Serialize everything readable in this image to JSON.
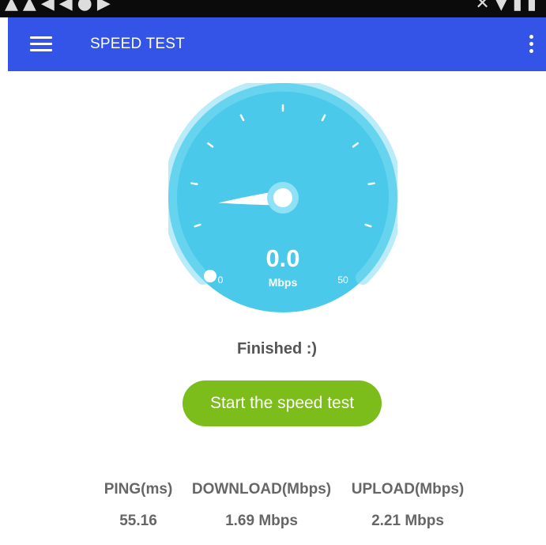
{
  "app_bar": {
    "title": "SPEED TEST"
  },
  "gauge": {
    "speed_value": "0.0",
    "unit": "Mbps",
    "min_label": "0",
    "max_label": "50",
    "needle_level": 0.15,
    "colors": {
      "face": "#4bc9ea",
      "inner": "#55cff0",
      "ring": "#7fdcf3",
      "marks": "#ffffff"
    }
  },
  "status": {
    "text": "Finished :)"
  },
  "start_button": {
    "label": "Start the speed test",
    "color": "#7cbd1b"
  },
  "metrics": {
    "ping": {
      "label": "PING(ms)",
      "value": "55.16"
    },
    "download": {
      "label": "DOWNLOAD(Mbps)",
      "value": "1.69 Mbps"
    },
    "upload": {
      "label": "UPLOAD(Mbps)",
      "value": "2.21 Mbps"
    }
  },
  "colors": {
    "app_bar": "#3454e8",
    "status_bar": "#0b0b0b",
    "text": "#666666"
  }
}
